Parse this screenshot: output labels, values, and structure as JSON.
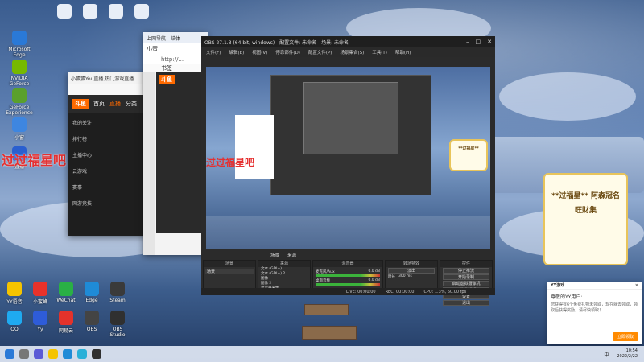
{
  "desktop": {
    "left_icons": [
      {
        "label": "Microsoft Edge",
        "color": "#2a79d7"
      },
      {
        "label": "NVIDIA GeForce",
        "color": "#76b900"
      },
      {
        "label": "GeForce Experience",
        "color": "#5aa02c"
      },
      {
        "label": "小窗",
        "color": "#3e86e0"
      },
      {
        "label": "直播",
        "color": "#2a5fcf"
      }
    ],
    "overlay_text": "过过福星吧",
    "bottom_icons": [
      {
        "label": "YY语音",
        "color": "#f5c400"
      },
      {
        "label": "小蜜蜂",
        "color": "#e8322b"
      },
      {
        "label": "WeChat",
        "color": "#2ab045"
      },
      {
        "label": "Edge",
        "color": "#1f8bd7"
      },
      {
        "label": "Steam",
        "color": "#3a3a3a"
      },
      {
        "label": "QQ",
        "color": "#1faaf1"
      },
      {
        "label": "Yy",
        "color": "#2e5cd8"
      },
      {
        "label": "网易云",
        "color": "#e3322b"
      },
      {
        "label": "OBS",
        "color": "#444"
      },
      {
        "label": "OBS Studio",
        "color": "#303030"
      }
    ]
  },
  "browser_back": {
    "title": "小蛋蛋You直播,热门游戏直播",
    "brand": "斗鱼",
    "tabs": [
      "首页",
      "直播",
      "分类"
    ],
    "sidebar": [
      "我的关注",
      "排行榜",
      "主播中心",
      "云游戏",
      "赛事",
      "网游竞技"
    ]
  },
  "browser_front": {
    "title": "上网导航 - 结体",
    "tab2": "小蛋",
    "url": "http://...",
    "bookmark": "书签",
    "brand": "斗鱼"
  },
  "obs": {
    "title": "OBS 27.1.3 (64 bit, windows) - 配置文件: 未命名 - 场景: 未命名",
    "menu": [
      "文件(F)",
      "编辑(E)",
      "视图(V)",
      "停靠部件(D)",
      "配置文件(P)",
      "场景集合(S)",
      "工具(T)",
      "帮助(H)"
    ],
    "scene_label": "场景",
    "source_tab": "来源",
    "docks": {
      "scenes": "场景",
      "sources": "来源",
      "mixer": "混音器",
      "transitions": "转场特效",
      "controls": "控件"
    },
    "sources_list": [
      "文本 (GDI+)",
      "文本 (GDI+) 2",
      "图像",
      "图像 2",
      "显示器采集"
    ],
    "mixer_tracks": [
      {
        "name": "麦克风/Aux",
        "db": "0.0 dB"
      },
      {
        "name": "桌面音频",
        "db": "0.0 dB"
      }
    ],
    "transition": {
      "type": "淡出",
      "duration_label": "时长",
      "duration": "300 ms"
    },
    "controls": [
      "停止推流",
      "开始录制",
      "启动虚拟摄像机",
      "工作室模式",
      "设置",
      "退出"
    ],
    "status": [
      "LIVE: 00:00:00",
      "REC: 00:00:00",
      "CPU: 1.3%, 60.00 fps"
    ]
  },
  "signs": [
    {
      "text": "**过福星**"
    },
    {
      "text": "**过福星** 阿森冠名 旺财集"
    }
  ],
  "notification": {
    "title": "YY游戏",
    "heading": "尊敬的YY用户:",
    "body": "您获得有6个免费礼物未领取，现在就去领取，领取后获得奖励，请尽快领取！",
    "button": "立即领取"
  },
  "taskbar": {
    "time": "10:54",
    "date": "2022/2/22",
    "lang": "中"
  }
}
